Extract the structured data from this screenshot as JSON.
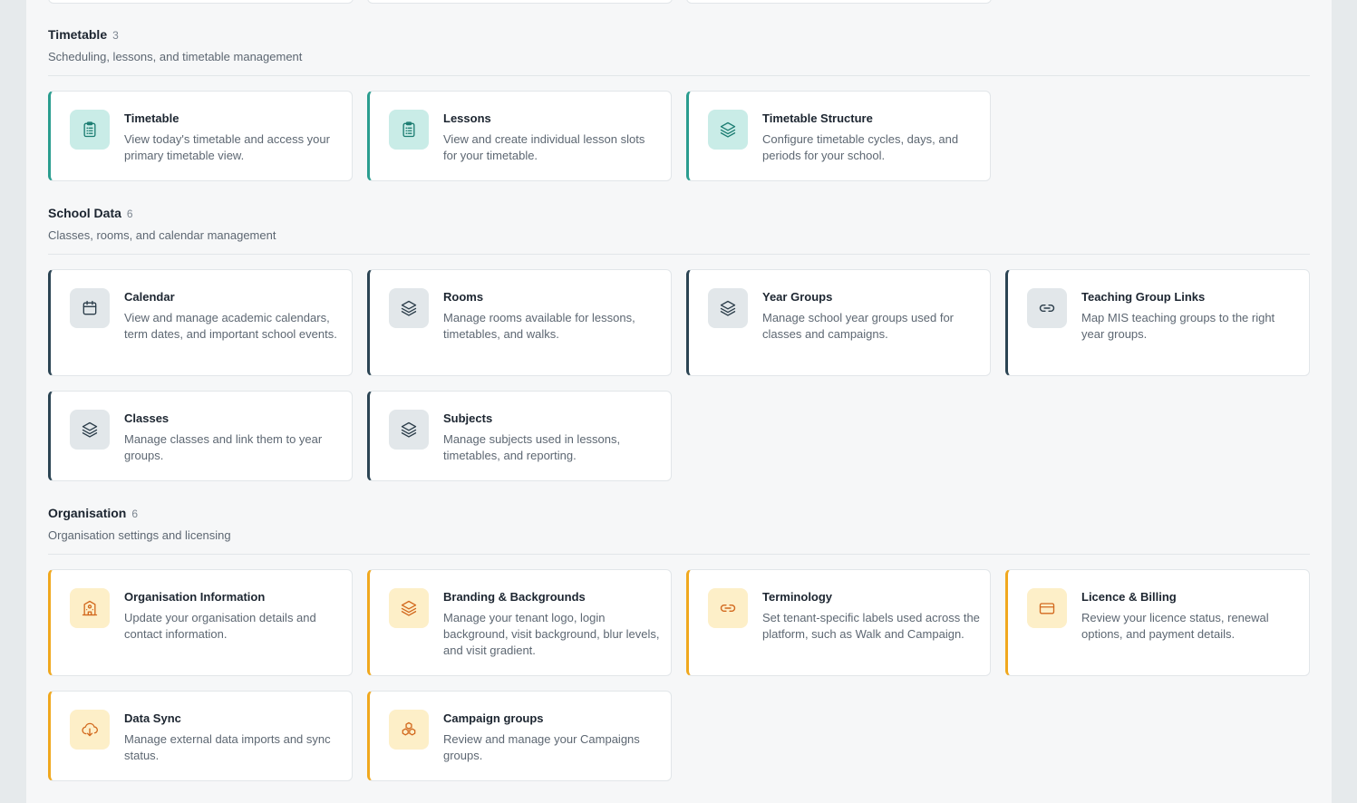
{
  "sections": [
    {
      "title": "Timetable",
      "count": "3",
      "description": "Scheduling, lessons, and timetable management",
      "cards": [
        {
          "title": "Timetable",
          "description": "View today's timetable and access your primary timetable view.",
          "icon": "clipboard-icon"
        },
        {
          "title": "Lessons",
          "description": "View and create individual lesson slots for your timetable.",
          "icon": "clipboard-icon"
        },
        {
          "title": "Timetable Structure",
          "description": "Configure timetable cycles, days, and periods for your school.",
          "icon": "layers-icon"
        }
      ]
    },
    {
      "title": "School Data",
      "count": "6",
      "description": "Classes, rooms, and calendar management",
      "cards": [
        {
          "title": "Calendar",
          "description": "View and manage academic calendars, term dates, and important school events.",
          "icon": "calendar-icon"
        },
        {
          "title": "Rooms",
          "description": "Manage rooms available for lessons, timetables, and walks.",
          "icon": "layers-icon"
        },
        {
          "title": "Year Groups",
          "description": "Manage school year groups used for classes and campaigns.",
          "icon": "layers-icon"
        },
        {
          "title": "Teaching Group Links",
          "description": "Map MIS teaching groups to the right year groups.",
          "icon": "link-icon"
        },
        {
          "title": "Classes",
          "description": "Manage classes and link them to year groups.",
          "icon": "layers-icon"
        },
        {
          "title": "Subjects",
          "description": "Manage subjects used in lessons, timetables, and reporting.",
          "icon": "layers-icon"
        }
      ]
    },
    {
      "title": "Organisation",
      "count": "6",
      "description": "Organisation settings and licensing",
      "cards": [
        {
          "title": "Organisation Information",
          "description": "Update your organisation details and contact information.",
          "icon": "school-building-icon"
        },
        {
          "title": "Branding & Backgrounds",
          "description": "Manage your tenant logo, login background, visit background, blur levels, and visit gradient.",
          "icon": "layers-icon"
        },
        {
          "title": "Terminology",
          "description": "Set tenant-specific labels used across the platform, such as Walk and Campaign.",
          "icon": "link-icon"
        },
        {
          "title": "Licence & Billing",
          "description": "Review your licence status, renewal options, and payment details.",
          "icon": "credit-card-icon"
        },
        {
          "title": "Data Sync",
          "description": "Manage external data imports and sync status.",
          "icon": "cloud-download-icon"
        },
        {
          "title": "Campaign groups",
          "description": "Review and manage your Campaigns groups.",
          "icon": "boxes-icon"
        }
      ]
    }
  ]
}
